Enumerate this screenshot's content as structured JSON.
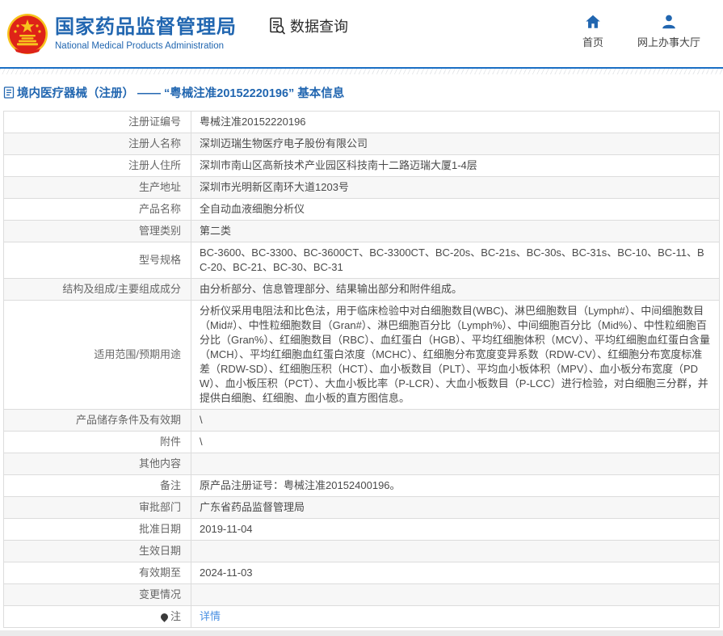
{
  "header": {
    "title": "国家药品监督管理局",
    "subtitle": "National Medical Products Administration",
    "nav_data_query": "数据查询",
    "nav_home": "首页",
    "nav_hall": "网上办事大厅"
  },
  "breadcrumb": {
    "text": "境内医疗器械（注册） —— “粤械注准20152220196” 基本信息"
  },
  "colors": {
    "brand_blue": "#2166b0",
    "divider_blue": "#1a6fc4",
    "link_blue": "#4a90e2",
    "emblem_red": "#de2318",
    "emblem_gold": "#f7c31d",
    "table_border": "#dcdcdc",
    "stripe_gray": "#f7f7f7"
  },
  "table": {
    "rows": [
      {
        "label": "注册证编号",
        "value": "粤械注准20152220196"
      },
      {
        "label": "注册人名称",
        "value": "深圳迈瑞生物医疗电子股份有限公司"
      },
      {
        "label": "注册人住所",
        "value": "深圳市南山区高新技术产业园区科技南十二路迈瑞大厦1-4层"
      },
      {
        "label": "生产地址",
        "value": "深圳市光明新区南环大道1203号"
      },
      {
        "label": "产品名称",
        "value": "全自动血液细胞分析仪"
      },
      {
        "label": "管理类别",
        "value": "第二类"
      },
      {
        "label": "型号规格",
        "value": "BC-3600、BC-3300、BC-3600CT、BC-3300CT、BC-20s、BC-21s、BC-30s、BC-31s、BC-10、BC-11、BC-20、BC-21、BC-30、BC-31"
      },
      {
        "label": "结构及组成/主要组成成分",
        "value": "由分析部分、信息管理部分、结果输出部分和附件组成。"
      },
      {
        "label": "适用范围/预期用途",
        "value": "分析仪采用电阻法和比色法，用于临床检验中对白细胞数目(WBC)、淋巴细胞数目（Lymph#）、中间细胞数目（Mid#）、中性粒细胞数目（Gran#）、淋巴细胞百分比（Lymph%）、中间细胞百分比（Mid%）、中性粒细胞百分比（Gran%）、红细胞数目（RBC）、血红蛋白（HGB）、平均红细胞体积（MCV）、平均红细胞血红蛋白含量（MCH）、平均红细胞血红蛋白浓度（MCHC）、红细胞分布宽度变异系数（RDW-CV）、红细胞分布宽度标准差（RDW-SD）、红细胞压积（HCT）、血小板数目（PLT）、平均血小板体积（MPV）、血小板分布宽度（PDW）、血小板压积（PCT）、大血小板比率（P-LCR）、大血小板数目（P-LCC）进行检验，对白细胞三分群，并提供白细胞、红细胞、血小板的直方图信息。"
      },
      {
        "label": "产品储存条件及有效期",
        "value": "\\"
      },
      {
        "label": "附件",
        "value": "\\"
      },
      {
        "label": "其他内容",
        "value": ""
      },
      {
        "label": "备注",
        "value": "原产品注册证号：粤械注准20152400196。"
      },
      {
        "label": "审批部门",
        "value": "广东省药品监督管理局"
      },
      {
        "label": "批准日期",
        "value": "2019-11-04"
      },
      {
        "label": "生效日期",
        "value": ""
      },
      {
        "label": "有效期至",
        "value": "2024-11-03"
      },
      {
        "label": "变更情况",
        "value": ""
      },
      {
        "label": "注",
        "value": "详情",
        "link": true,
        "note_icon": true
      }
    ]
  }
}
